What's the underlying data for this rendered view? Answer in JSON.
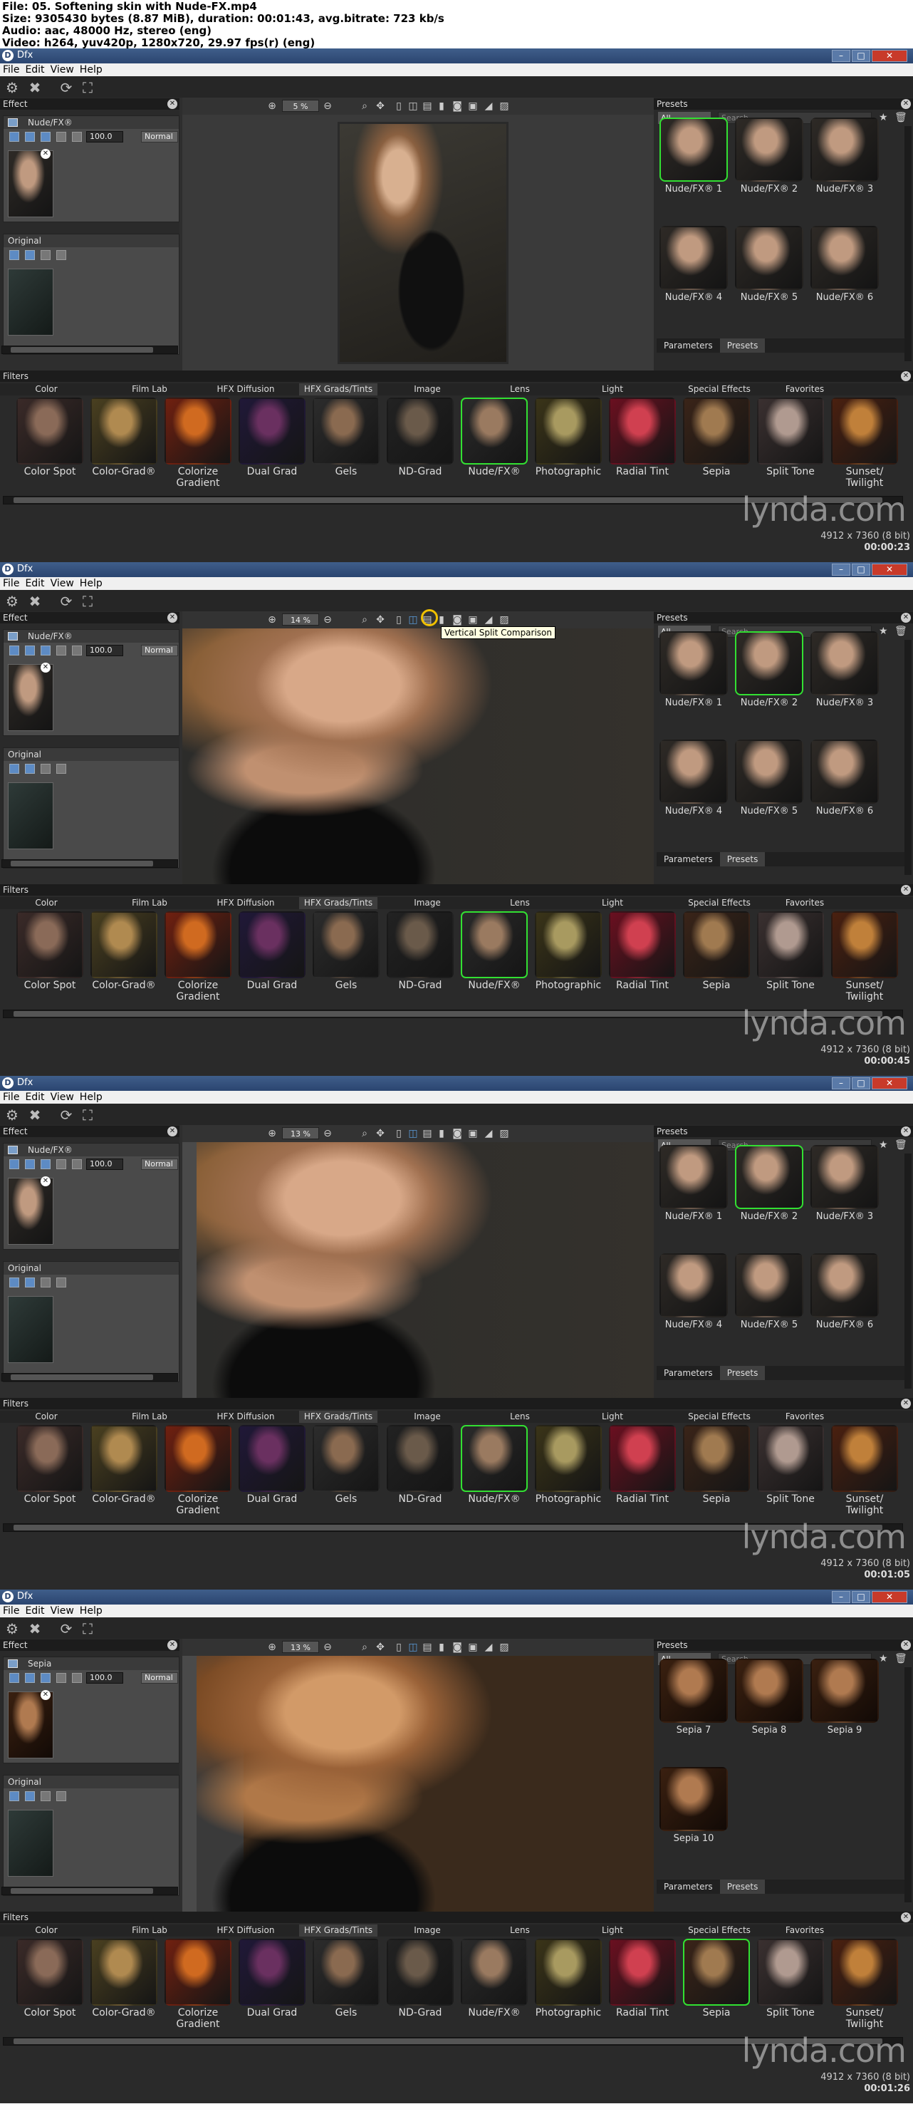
{
  "info": {
    "line1": "File: 05. Softening skin with Nude-FX.mp4",
    "line2": "Size: 9305430 bytes (8.87 MiB), duration: 00:01:43, avg.bitrate: 723 kb/s",
    "line3": "Audio: aac, 48000 Hz, stereo (eng)",
    "line4": "Video: h264, yuv420p, 1280x720, 29.97 fps(r) (eng)"
  },
  "app": {
    "title": "Dfx",
    "logo": "D",
    "menu": [
      "File",
      "Edit",
      "View",
      "Help"
    ],
    "effect_label": "Effect",
    "presets_label": "Presets",
    "filters_label": "Filters",
    "original_label": "Original",
    "opacity": "100.0",
    "blend": "Normal",
    "presets_filter": "All",
    "search_placeholder": "Search",
    "tab_parameters": "Parameters",
    "tab_presets": "Presets",
    "filter_tabs": [
      "Color",
      "Film Lab",
      "HFX Diffusion",
      "HFX Grads/Tints",
      "Image",
      "Lens",
      "Light",
      "Special Effects",
      "Favorites"
    ],
    "filter_items": [
      "Color Spot",
      "Color-Grad®",
      "Colorize Gradient",
      "Dual Grad",
      "Gels",
      "ND-Grad",
      "Nude/FX®",
      "Photographic",
      "Radial Tint",
      "Sepia",
      "Split Tone",
      "Sunset/ Twilight"
    ],
    "watermark": "lynda.com",
    "dims": "4912 x 7360 (8 bit)",
    "tooltip": "Vertical Split Comparison"
  },
  "frames": [
    {
      "timecode": "00:00:23",
      "layer_name": "Nude/FX®",
      "zoom": "5 %",
      "selected_filter": 6,
      "selected_preset": 0,
      "presets": [
        "Nude/FX® 1",
        "Nude/FX® 2",
        "Nude/FX® 3",
        "Nude/FX® 4",
        "Nude/FX® 5",
        "Nude/FX® 6"
      ]
    },
    {
      "timecode": "00:00:45",
      "layer_name": "Nude/FX®",
      "zoom": "14 %",
      "selected_filter": 6,
      "selected_preset": 1,
      "presets": [
        "Nude/FX® 1",
        "Nude/FX® 2",
        "Nude/FX® 3",
        "Nude/FX® 4",
        "Nude/FX® 5",
        "Nude/FX® 6"
      ]
    },
    {
      "timecode": "00:01:05",
      "layer_name": "Nude/FX®",
      "zoom": "13 %",
      "selected_filter": 6,
      "selected_preset": 1,
      "presets": [
        "Nude/FX® 1",
        "Nude/FX® 2",
        "Nude/FX® 3",
        "Nude/FX® 4",
        "Nude/FX® 5",
        "Nude/FX® 6"
      ]
    },
    {
      "timecode": "00:01:26",
      "layer_name": "Sepia",
      "zoom": "13 %",
      "selected_filter": 9,
      "selected_preset": -1,
      "presets": [
        "Sepia 7",
        "Sepia 8",
        "Sepia 9",
        "Sepia 10"
      ]
    }
  ],
  "colors": {
    "titlebar": "#2b4570",
    "selection_green": "#32e032",
    "canvas_bg": "#3a3a3a",
    "panel_bg": "#2a2a2a"
  }
}
